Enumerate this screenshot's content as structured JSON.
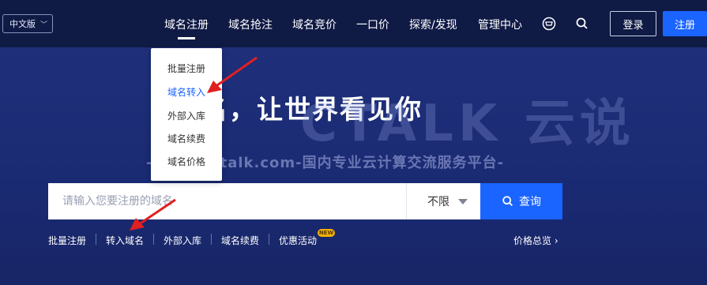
{
  "header": {
    "language": "中文版",
    "nav": [
      "域名注册",
      "域名抢注",
      "域名竞价",
      "一口价",
      "探索/发现",
      "管理中心"
    ],
    "login": "登录",
    "register": "注册"
  },
  "dropdown": {
    "items": [
      "批量注册",
      "域名转入",
      "外部入库",
      "域名续费",
      "域名价格"
    ],
    "active_index": 1
  },
  "hero": {
    "title": "名，让世界看见你"
  },
  "watermark": {
    "brand": "CTALK 云说",
    "sub": "-www.dctalk.com-国内专业云计算交流服务平台-"
  },
  "search": {
    "placeholder": "请输入您要注册的域名",
    "select": "不限",
    "button": "查询"
  },
  "quick_links": [
    "批量注册",
    "转入域名",
    "外部入库",
    "域名续费",
    "优惠活动"
  ],
  "badge": "NEW",
  "price_link": "价格总览",
  "colors": {
    "accent": "#1a64ff",
    "annotation": "#e02020"
  }
}
